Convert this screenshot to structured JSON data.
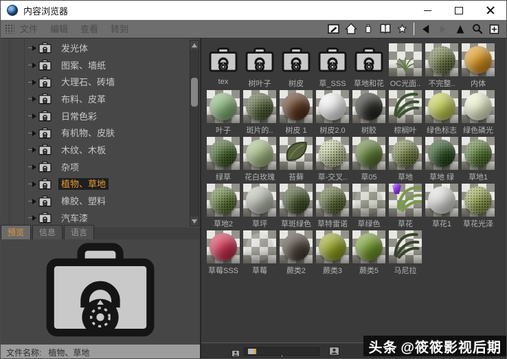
{
  "window": {
    "title": "内容浏览器"
  },
  "menubar": {
    "menus": [
      "文件",
      "编辑",
      "查看",
      "转到"
    ],
    "toolbar_icons": [
      {
        "name": "edit-icon"
      },
      {
        "name": "home-icon"
      },
      {
        "name": "preset-jar-icon"
      },
      {
        "name": "catalog-book-icon"
      },
      {
        "name": "favorites-star-icon"
      },
      {
        "name": "separator"
      },
      {
        "name": "back-icon"
      },
      {
        "name": "forward-icon",
        "dim": true
      },
      {
        "name": "up-icon"
      },
      {
        "name": "search-icon"
      },
      {
        "name": "add-browser-icon"
      }
    ]
  },
  "sidebar": {
    "tree": [
      {
        "label": "发光体"
      },
      {
        "label": "图案、墙纸"
      },
      {
        "label": "大理石、砖墙"
      },
      {
        "label": "布料、皮革"
      },
      {
        "label": "日常色彩"
      },
      {
        "label": "有机物、皮肤"
      },
      {
        "label": "木纹、木板"
      },
      {
        "label": "杂项"
      },
      {
        "label": "植物、草地",
        "selected": true
      },
      {
        "label": "橡胶、塑料"
      },
      {
        "label": "汽车漆"
      },
      {
        "label": ""
      }
    ],
    "tabs": [
      {
        "label": "预览",
        "active": true
      },
      {
        "label": "信息",
        "active": false
      },
      {
        "label": "语言",
        "active": false
      }
    ]
  },
  "statusbar": {
    "label": "文件名称:",
    "value": "植物、草地"
  },
  "content": {
    "items": [
      {
        "label": "tex",
        "type": "folder"
      },
      {
        "label": "树叶子",
        "type": "folder"
      },
      {
        "label": "树皮",
        "type": "folder"
      },
      {
        "label": "草_SSS",
        "type": "folder"
      },
      {
        "label": "草地和花",
        "type": "folder"
      },
      {
        "label": "OC光面..",
        "type": "tuft",
        "color": "#5e7a3c"
      },
      {
        "label": "不完整..",
        "type": "sphere",
        "color": "#77824f",
        "texture": "grass"
      },
      {
        "label": "内体",
        "type": "sphere",
        "color": "#d8921e"
      },
      {
        "label": "叶子",
        "type": "sphere",
        "color": "#86b27a"
      },
      {
        "label": "斑片的..",
        "type": "sphere",
        "color": "#5a683e",
        "texture": "grass"
      },
      {
        "label": "树皮 1",
        "type": "sphere",
        "color": "#5a341d"
      },
      {
        "label": "树皮2.0",
        "type": "sphere",
        "color": "#efefef"
      },
      {
        "label": "树胶",
        "type": "sphere",
        "color": "#2a2a26"
      },
      {
        "label": "棕榈叶",
        "type": "fronds",
        "color": "#3c5231"
      },
      {
        "label": "绿色标志",
        "type": "sphere",
        "color": "#c0ca55"
      },
      {
        "label": "绿色磷光",
        "type": "sphere",
        "color": "#e9efcb"
      },
      {
        "label": "绿草",
        "type": "sphere",
        "color": "#49682f",
        "texture": "grass"
      },
      {
        "label": "花白玫瑰",
        "type": "sphere",
        "color": "#a3b983"
      },
      {
        "label": "苔藓",
        "type": "leaf",
        "color": "#55613a"
      },
      {
        "label": "草-交叉..",
        "type": "sphere",
        "color": "#c8d2a4",
        "texture": "grass"
      },
      {
        "label": "草05",
        "type": "sphere",
        "color": "#5c7a33"
      },
      {
        "label": "草地",
        "type": "sphere",
        "color": "#7e8c4d",
        "texture": "grass"
      },
      {
        "label": "草地 绿",
        "type": "sphere",
        "color": "#2e5426",
        "texture": "grass"
      },
      {
        "label": "草地1",
        "type": "sphere",
        "color": "#5c7f3a",
        "texture": "grass"
      },
      {
        "label": "草地2",
        "type": "sphere",
        "color": "#68833f",
        "texture": "grass"
      },
      {
        "label": "草坪",
        "type": "sphere",
        "color": "#b8bcb0"
      },
      {
        "label": "草斑绿色",
        "type": "sphere",
        "color": "#4a5a31",
        "texture": "grass"
      },
      {
        "label": "草特雷诺",
        "type": "sphere",
        "color": "#677441",
        "texture": "grass"
      },
      {
        "label": "草绿色",
        "type": "ghost",
        "color": "#a9b394"
      },
      {
        "label": "草花",
        "type": "gem",
        "color": "#7a9a4a"
      },
      {
        "label": "草花1",
        "type": "sphere",
        "color": "#dbdbd8"
      },
      {
        "label": "草花光泽",
        "type": "sphere",
        "color": "#9cab57",
        "texture": "grass"
      },
      {
        "label": "草莓SSS",
        "type": "sphere",
        "color": "#cb3150"
      },
      {
        "label": "草莓",
        "type": "ghost",
        "color": "#d8d8d4"
      },
      {
        "label": "蕨类2",
        "type": "sphere",
        "color": "#4b4139"
      },
      {
        "label": "蕨类3",
        "type": "sphere",
        "color": "#93a023"
      },
      {
        "label": "蕨类5",
        "type": "sphere",
        "color": "#70962a"
      },
      {
        "label": "马尼拉",
        "type": "fronds",
        "color": "#3a432d"
      }
    ],
    "size_slider": {
      "position_percent": 3
    }
  },
  "watermark": {
    "brand": "头条",
    "handle": "@筱筱影视后期"
  },
  "colors": {
    "accent_orange": "#e69a33",
    "selection_bg": "#1f1f1f",
    "titlebar_bg": "#ffffff"
  }
}
